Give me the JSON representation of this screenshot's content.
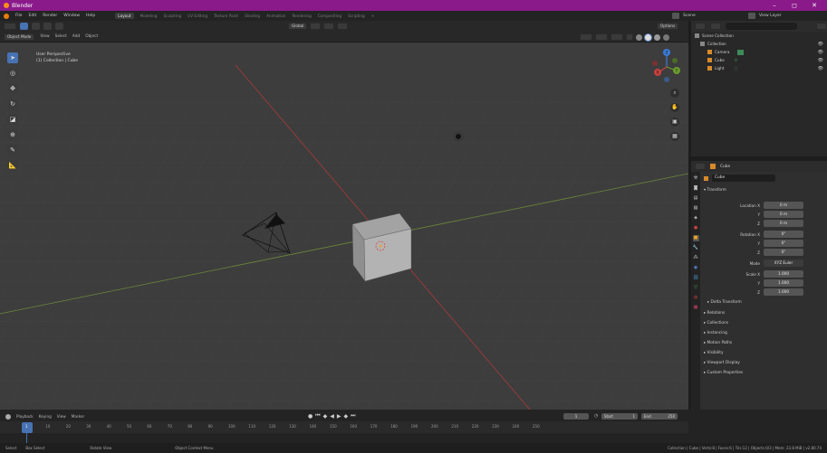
{
  "window": {
    "title": "Blender",
    "controls": [
      "–",
      "◻",
      "✕"
    ]
  },
  "menubar": {
    "menus": [
      "File",
      "Edit",
      "Render",
      "Window",
      "Help"
    ],
    "workspaces": [
      "Layout",
      "Modeling",
      "Sculpting",
      "UV Editing",
      "Texture Paint",
      "Shading",
      "Animation",
      "Rendering",
      "Compositing",
      "Scripting"
    ],
    "active_workspace": "Layout",
    "add_tab": "+",
    "scene": "Scene",
    "view_layer": "View Layer"
  },
  "viewport_header": {
    "transform_orientation": "Global",
    "mode": "Object Mode",
    "menus": [
      "View",
      "Select",
      "Add",
      "Object"
    ],
    "options": "Options"
  },
  "viewport": {
    "info_line1": "User Perspective",
    "info_line2": "(1) Collection | Cube"
  },
  "toolbar": {
    "tools": [
      "select-tool",
      "cursor-tool",
      "move-tool",
      "rotate-tool",
      "scale-tool",
      "transform-tool",
      "annotate-tool",
      "measure-tool"
    ]
  },
  "gizmo": {
    "x_label": "X",
    "y_label": "Y",
    "z_label": "Z"
  },
  "outliner": {
    "search_placeholder": "",
    "items": [
      {
        "label": "Scene Collection",
        "indent": 0
      },
      {
        "label": "Collection",
        "indent": 1
      },
      {
        "label": "Camera",
        "indent": 2
      },
      {
        "label": "Cube",
        "indent": 2
      },
      {
        "label": "Light",
        "indent": 2
      }
    ]
  },
  "properties": {
    "object_name": "Cube",
    "object_field": "Cube",
    "section_transform": "Transform",
    "location_label": "Location X",
    "rotation_label": "Rotation X",
    "scale_label": "Scale X",
    "y_label": "Y",
    "z_label": "Z",
    "location": [
      "0 m",
      "0 m",
      "0 m"
    ],
    "rotation": [
      "0°",
      "0°",
      "0°"
    ],
    "mode_label": "Mode",
    "mode_value": "XYZ Euler",
    "scale": [
      "1.000",
      "1.000",
      "1.000"
    ],
    "sections": [
      "Delta Transform",
      "Relations",
      "Collections",
      "Instancing",
      "Motion Paths",
      "Visibility",
      "Viewport Display",
      "Custom Properties"
    ]
  },
  "timeline": {
    "menus": [
      "Playback",
      "Keying",
      "View",
      "Marker"
    ],
    "current_frame": "1",
    "start_label": "Start",
    "start": "1",
    "end_label": "End",
    "end": "250",
    "ticks": [
      "1",
      "10",
      "20",
      "30",
      "40",
      "50",
      "60",
      "70",
      "80",
      "90",
      "100",
      "110",
      "120",
      "130",
      "140",
      "150",
      "160",
      "170",
      "180",
      "190",
      "200",
      "210",
      "220",
      "230",
      "240",
      "250"
    ]
  },
  "statusbar": {
    "left": [
      "Select",
      "Box Select",
      "Rotate View",
      "Object Context Menu"
    ],
    "right": "Collection | Cube | Verts:8 | Faces:6 | Tris:12 | Objects:0/3 | Mem: 23.8 MiB | v2.80.74"
  }
}
